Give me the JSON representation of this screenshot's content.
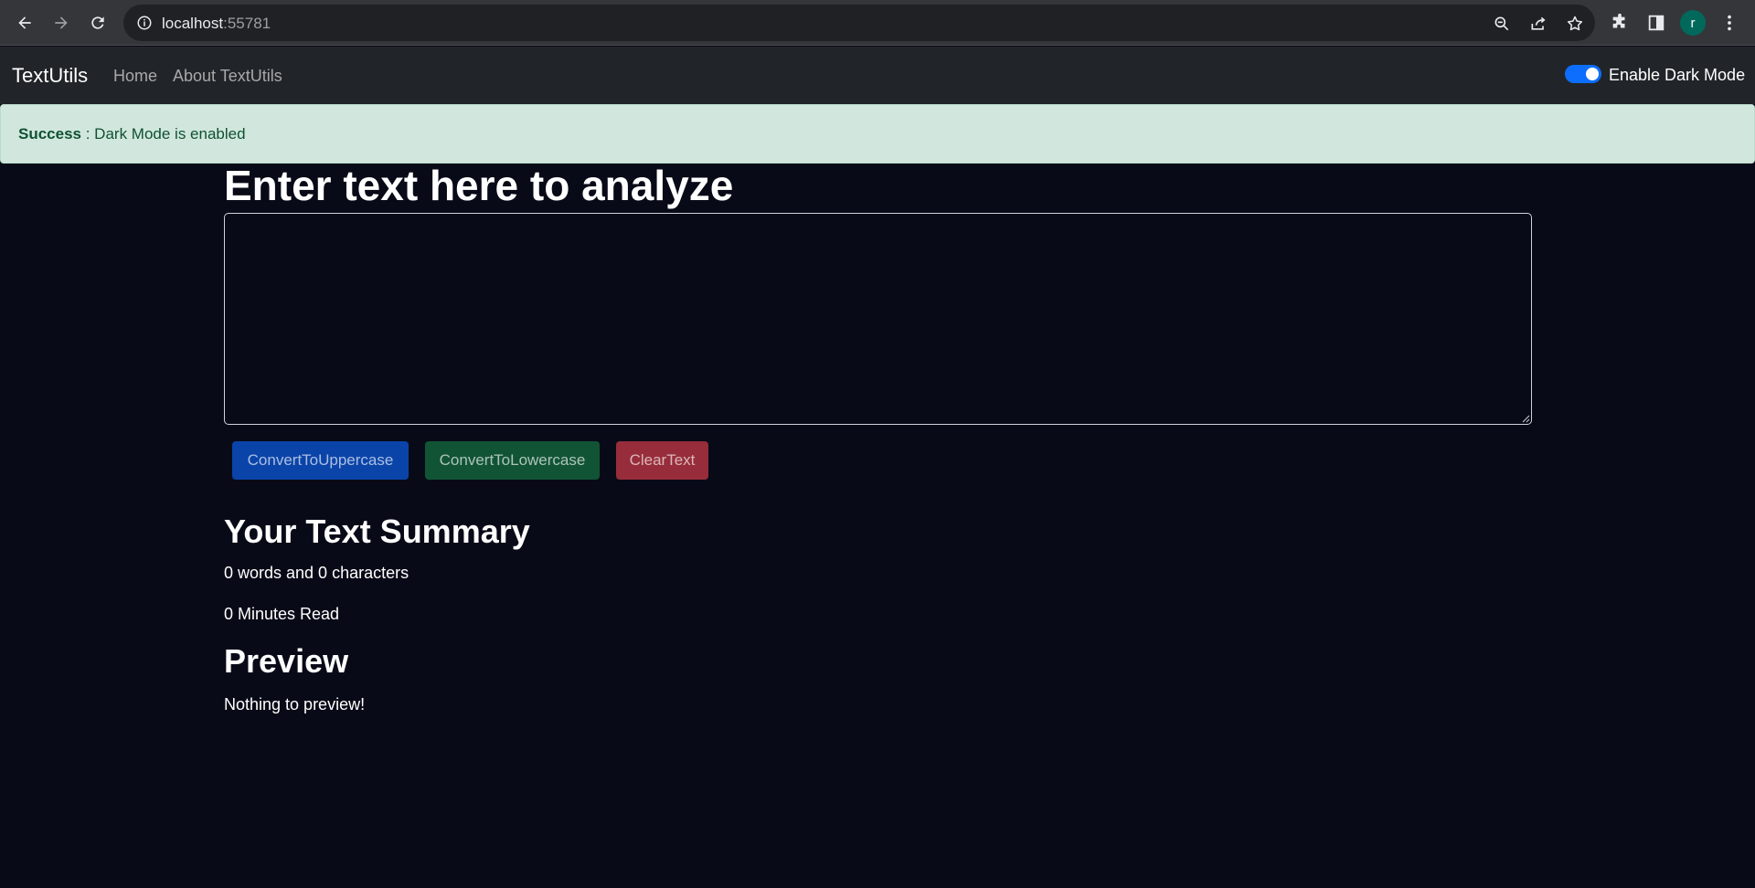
{
  "browser": {
    "url_host": "localhost",
    "url_port": ":55781",
    "avatar_letter": "r"
  },
  "navbar": {
    "brand": "TextUtils",
    "links": [
      "Home",
      "About TextUtils"
    ],
    "dark_mode_label": "Enable Dark Mode",
    "dark_mode_enabled": true
  },
  "alert": {
    "type": "Success",
    "separator": " : ",
    "message": "Dark Mode is enabled"
  },
  "main": {
    "heading": "Enter text here to analyze",
    "textarea_value": "",
    "buttons": {
      "uppercase": "ConvertToUppercase",
      "lowercase": "ConvertToLowercase",
      "clear": "ClearText"
    },
    "summary_heading": "Your Text Summary",
    "summary_counts": "0 words and 0 characters",
    "read_time": "0 Minutes Read",
    "preview_heading": "Preview",
    "preview_text": "Nothing to preview!"
  },
  "colors": {
    "page_bg": "#090a17",
    "navbar_bg": "#212529",
    "alert_bg": "#d1e7dd",
    "alert_text": "#0f5132",
    "primary": "#0b44a9",
    "success": "#115435",
    "danger": "#972d3a",
    "switch_on": "#0d6efd"
  }
}
